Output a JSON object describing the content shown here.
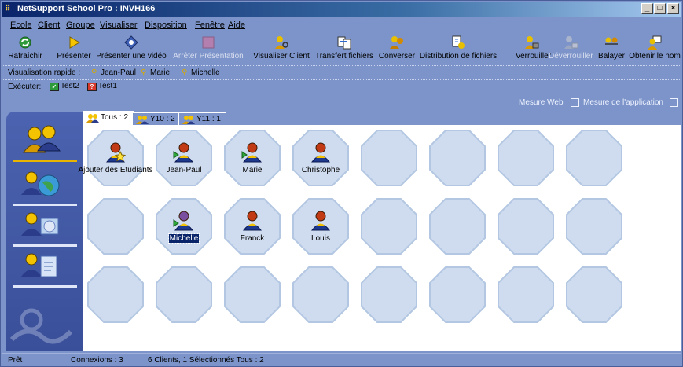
{
  "window": {
    "title": "NetSupport School Pro : INVH166"
  },
  "menu": [
    "Ecole",
    "Client",
    "Groupe",
    "Visualiser",
    "Disposition",
    "Fenêtre",
    "Aide"
  ],
  "toolbar": [
    {
      "label": "Rafraîchir",
      "icon": "refresh-icon",
      "disabled": false
    },
    {
      "label": "Présenter",
      "icon": "play-icon",
      "disabled": false
    },
    {
      "label": "Présenter une vidéo",
      "icon": "video-icon",
      "disabled": false
    },
    {
      "label": "Arrêter Présentation",
      "icon": "stop-icon",
      "disabled": true
    },
    {
      "label": "Visualiser Client",
      "icon": "view-client-icon",
      "disabled": false
    },
    {
      "label": "Transfert fichiers",
      "icon": "file-transfer-icon",
      "disabled": false
    },
    {
      "label": "Converser",
      "icon": "chat-icon",
      "disabled": false
    },
    {
      "label": "Distribution de fichiers",
      "icon": "file-distribution-icon",
      "disabled": false
    },
    {
      "label": "Verrouiller",
      "icon": "lock-icon",
      "disabled": false
    },
    {
      "label": "Déverrouiller",
      "icon": "unlock-icon",
      "disabled": true
    },
    {
      "label": "Balayer",
      "icon": "scan-icon",
      "disabled": false
    },
    {
      "label": "Obtenir le nom",
      "icon": "get-name-icon",
      "disabled": false
    }
  ],
  "quick_view": {
    "label": "Visualisation rapide :",
    "items": [
      "Jean-Paul",
      "Marie",
      "Michelle"
    ]
  },
  "run": {
    "label": "Exécuter:",
    "items": [
      {
        "label": "Test2",
        "color": "#2e9b3a"
      },
      {
        "label": "Test1",
        "color": "#d8382a"
      }
    ]
  },
  "measure": {
    "web": "Mesure Web",
    "app": "Mesure de l'application"
  },
  "tabs": [
    {
      "label": "Tous : 2"
    },
    {
      "label": "Y10 : 2"
    },
    {
      "label": "Y11 : 1"
    }
  ],
  "clients": [
    {
      "name": "Ajouter des Etudiants",
      "kind": "add"
    },
    {
      "name": "Jean-Paul",
      "kind": "connected"
    },
    {
      "name": "Marie",
      "kind": "connected"
    },
    {
      "name": "Christophe",
      "kind": "idle"
    },
    {
      "name": "Michelle",
      "kind": "selected"
    },
    {
      "name": "Franck",
      "kind": "idle"
    },
    {
      "name": "Louis",
      "kind": "idle"
    }
  ],
  "status": {
    "ready": "Prêt",
    "connections": "Connexions : 3",
    "summary": "6 Clients, 1 Sélectionnés  Tous : 2"
  },
  "colors": {
    "frame": "#7c94c9",
    "octagon": "#cfdcef",
    "octagon_border": "#b3c7e3",
    "title_start": "#0a246a"
  }
}
